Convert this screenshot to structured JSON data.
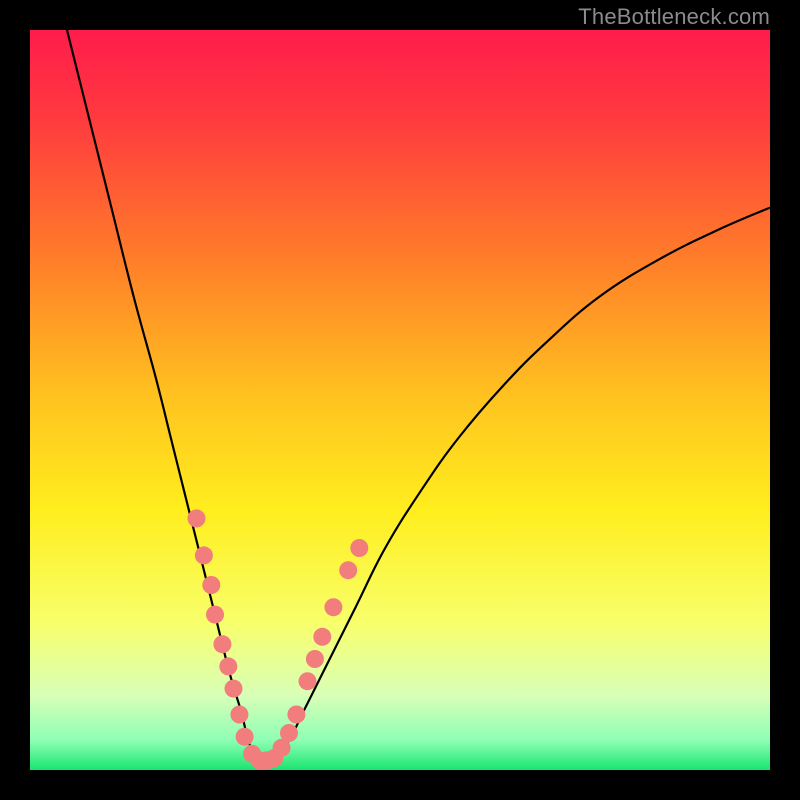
{
  "watermark": "TheBottleneck.com",
  "chart_data": {
    "type": "line",
    "title": "",
    "xlabel": "",
    "ylabel": "",
    "xlim": [
      0,
      100
    ],
    "ylim": [
      0,
      100
    ],
    "grid": false,
    "legend": false,
    "background_gradient_stops": [
      {
        "offset": 0.0,
        "color": "#ff1c4b"
      },
      {
        "offset": 0.12,
        "color": "#ff3a3f"
      },
      {
        "offset": 0.3,
        "color": "#ff7a2a"
      },
      {
        "offset": 0.5,
        "color": "#ffc41f"
      },
      {
        "offset": 0.65,
        "color": "#ffee1e"
      },
      {
        "offset": 0.8,
        "color": "#f8ff6a"
      },
      {
        "offset": 0.9,
        "color": "#d8ffb8"
      },
      {
        "offset": 0.96,
        "color": "#8dffb4"
      },
      {
        "offset": 1.0,
        "color": "#19e56f"
      }
    ],
    "series": [
      {
        "name": "bottleneck-curve",
        "color": "#000000",
        "stroke_width": 2.2,
        "x": [
          5,
          8,
          11,
          14,
          17,
          19,
          21,
          23,
          25,
          27,
          28.5,
          29.5,
          30.5,
          31.5,
          33,
          35,
          37,
          40,
          44,
          48,
          53,
          58,
          64,
          70,
          77,
          85,
          93,
          100
        ],
        "y": [
          100,
          88,
          76,
          64,
          53,
          45,
          37,
          29,
          21,
          13,
          8,
          4,
          1.5,
          1,
          1.5,
          4,
          8,
          14,
          22,
          30,
          38,
          45,
          52,
          58,
          64,
          69,
          73,
          76
        ]
      }
    ],
    "marker_series": {
      "name": "highlight-dots",
      "color": "#f27d7d",
      "radius": 9,
      "points": [
        {
          "x": 22.5,
          "y": 34
        },
        {
          "x": 23.5,
          "y": 29
        },
        {
          "x": 24.5,
          "y": 25
        },
        {
          "x": 25.0,
          "y": 21
        },
        {
          "x": 26.0,
          "y": 17
        },
        {
          "x": 26.8,
          "y": 14
        },
        {
          "x": 27.5,
          "y": 11
        },
        {
          "x": 28.3,
          "y": 7.5
        },
        {
          "x": 29.0,
          "y": 4.5
        },
        {
          "x": 30.0,
          "y": 2.2
        },
        {
          "x": 31.0,
          "y": 1.3
        },
        {
          "x": 32.0,
          "y": 1.3
        },
        {
          "x": 33.0,
          "y": 1.6
        },
        {
          "x": 34.0,
          "y": 3.0
        },
        {
          "x": 35.0,
          "y": 5.0
        },
        {
          "x": 36.0,
          "y": 7.5
        },
        {
          "x": 37.5,
          "y": 12
        },
        {
          "x": 38.5,
          "y": 15
        },
        {
          "x": 39.5,
          "y": 18
        },
        {
          "x": 41.0,
          "y": 22
        },
        {
          "x": 43.0,
          "y": 27
        },
        {
          "x": 44.5,
          "y": 30
        }
      ]
    }
  }
}
